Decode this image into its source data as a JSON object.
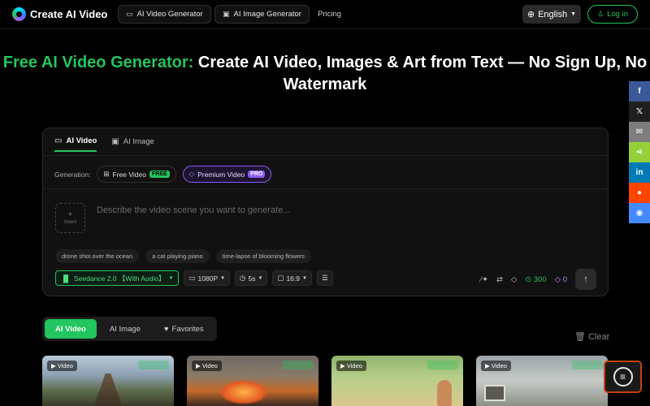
{
  "nav": {
    "brand": "Create AI Video",
    "items": [
      {
        "label": "AI Video Generator",
        "icon": "video-icon"
      },
      {
        "label": "AI Image Generator",
        "icon": "image-icon"
      }
    ],
    "pricing": "Pricing",
    "language": "English",
    "login": "Log in"
  },
  "hero": {
    "title_accent": "Free AI Video Generator:",
    "title_rest": " Create AI Video, Images & Art from Text — No Sign Up, No Watermark"
  },
  "generator": {
    "tabs": [
      "AI Video",
      "AI Image"
    ],
    "generation_label": "Generation:",
    "free_option": "Free Video",
    "free_badge": "FREE",
    "premium_option": "Premium Video",
    "premium_badge": "PRO",
    "insert_label": "Insert",
    "prompt_placeholder": "Describe the video scene you want to generate...",
    "suggestions": [
      "drone shot over the ocean",
      "a cat playing piano",
      "time-lapse of blooming flowers"
    ],
    "model": "Seedance 2.0 【With Audio】",
    "resolution": "1080P",
    "duration": "5s",
    "aspect": "16:9",
    "credits_green": "300",
    "credits_purple": "0"
  },
  "gallery": {
    "tabs": [
      "AI Video",
      "AI Image",
      "Favorites"
    ],
    "clear": "Clear",
    "cards": [
      {
        "badge": "Video",
        "scene": "wooden bridge over landscape"
      },
      {
        "badge": "Video",
        "scene": "explosion in city street"
      },
      {
        "badge": "Video",
        "scene": "girl in sunny field"
      },
      {
        "badge": "Video",
        "scene": "room with window"
      }
    ]
  },
  "share": [
    {
      "icon": "facebook-icon",
      "glyph": "f",
      "color": "#3b5998"
    },
    {
      "icon": "x-icon",
      "glyph": "𝕏",
      "color": "#1f1f1f"
    },
    {
      "icon": "email-icon",
      "glyph": "✉",
      "color": "#7d7d7d"
    },
    {
      "icon": "share-icon",
      "glyph": "⋖",
      "color": "#95d03a"
    },
    {
      "icon": "linkedin-icon",
      "glyph": "in",
      "color": "#007bb5"
    },
    {
      "icon": "reddit-icon",
      "glyph": "●",
      "color": "#ff4500"
    },
    {
      "icon": "messenger-icon",
      "glyph": "◉",
      "color": "#448aff"
    }
  ],
  "colors": {
    "accent": "#22c55e",
    "premium": "#8b5cf6",
    "background": "#000000"
  }
}
